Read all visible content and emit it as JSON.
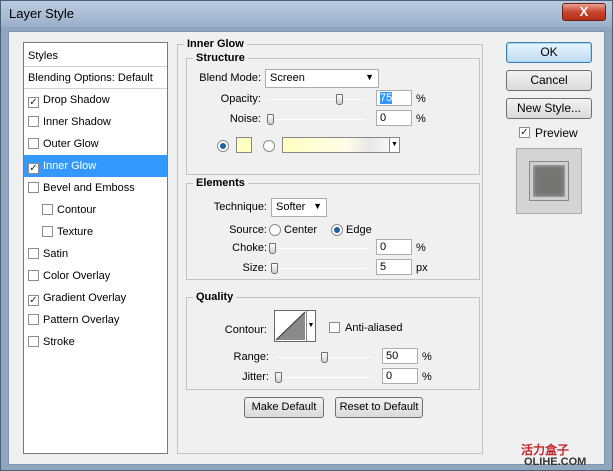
{
  "window": {
    "title": "Layer Style",
    "close": "X"
  },
  "styles_list": {
    "items": [
      {
        "label": "Styles",
        "checkbox": false
      },
      {
        "label": "Blending Options: Default",
        "checkbox": false
      },
      {
        "label": "Drop Shadow",
        "checkbox": true,
        "checked": true
      },
      {
        "label": "Inner Shadow",
        "checkbox": true,
        "checked": false
      },
      {
        "label": "Outer Glow",
        "checkbox": true,
        "checked": false
      },
      {
        "label": "Inner Glow",
        "checkbox": true,
        "checked": true,
        "selected": true
      },
      {
        "label": "Bevel and Emboss",
        "checkbox": true,
        "checked": false
      },
      {
        "label": "Contour",
        "checkbox": true,
        "checked": false,
        "indent": true
      },
      {
        "label": "Texture",
        "checkbox": true,
        "checked": false,
        "indent": true
      },
      {
        "label": "Satin",
        "checkbox": true,
        "checked": false
      },
      {
        "label": "Color Overlay",
        "checkbox": true,
        "checked": false
      },
      {
        "label": "Gradient Overlay",
        "checkbox": true,
        "checked": true
      },
      {
        "label": "Pattern Overlay",
        "checkbox": true,
        "checked": false
      },
      {
        "label": "Stroke",
        "checkbox": true,
        "checked": false
      }
    ]
  },
  "inner_glow": {
    "title": "Inner Glow",
    "structure": {
      "title": "Structure",
      "blend_mode_label": "Blend Mode:",
      "blend_mode_value": "Screen",
      "opacity_label": "Opacity:",
      "opacity_value": "75",
      "opacity_level": 75,
      "noise_label": "Noise:",
      "noise_value": "0",
      "noise_level": 0,
      "unit": "%",
      "color_swatch": "#ffffc0"
    },
    "elements": {
      "title": "Elements",
      "technique_label": "Technique:",
      "technique_value": "Softer",
      "source_label": "Source:",
      "source_center": "Center",
      "source_edge": "Edge",
      "choke_label": "Choke:",
      "choke_value": "0",
      "choke_level": 0,
      "choke_unit": "%",
      "size_label": "Size:",
      "size_value": "5",
      "size_level": 2,
      "size_unit": "px"
    },
    "quality": {
      "title": "Quality",
      "contour_label": "Contour:",
      "anti_aliased_label": "Anti-aliased",
      "range_label": "Range:",
      "range_value": "50",
      "range_level": 50,
      "range_unit": "%",
      "jitter_label": "Jitter:",
      "jitter_value": "0",
      "jitter_level": 0,
      "jitter_unit": "%"
    },
    "make_default": "Make Default",
    "reset_default": "Reset to Default"
  },
  "actions": {
    "ok": "OK",
    "cancel": "Cancel",
    "new_style": "New Style...",
    "preview_label": "Preview",
    "preview_checked": true
  },
  "watermark": {
    "line1": "活力盒子",
    "line2": "OLIHE.COM"
  }
}
